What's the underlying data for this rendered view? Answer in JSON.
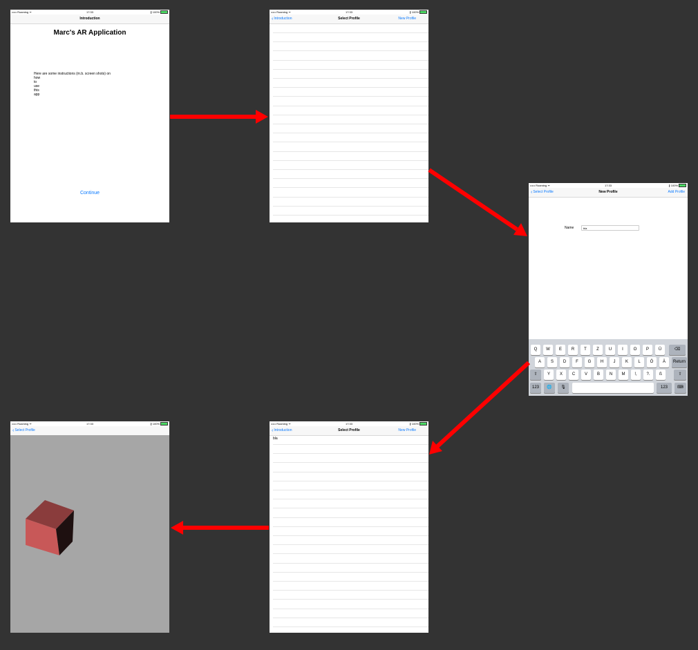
{
  "colors": {
    "background": "#333333",
    "link": "#0a7aff",
    "arrow": "#ff0000",
    "cube_front": "#c85858",
    "cube_top": "#8a3c3c",
    "cube_side": "#1e1010"
  },
  "status_bar": {
    "carrier": "••••• Roaming ᯤ",
    "time": "17:33",
    "battery": "∦ 100%"
  },
  "screen1": {
    "nav_title": "Introduction",
    "app_title": "Marc's AR Application",
    "instructions": [
      "Here are some instructions (m.b. screen shots) on",
      "how",
      "to",
      "use",
      "this",
      "app"
    ],
    "continue_label": "Continue"
  },
  "screen2": {
    "back_label": "Introduction",
    "nav_title": "Select Profile",
    "right_label": "New Profile"
  },
  "screen3": {
    "back_label": "Select Profile",
    "nav_title": "New Profile",
    "right_label": "Add Profile",
    "name_label": "Name",
    "name_value": "bla",
    "keyboard": {
      "row1": [
        "Q",
        "W",
        "E",
        "R",
        "T",
        "Z",
        "U",
        "I",
        "O",
        "P",
        "Ü",
        "⌫"
      ],
      "row2": [
        "A",
        "S",
        "D",
        "F",
        "G",
        "H",
        "J",
        "K",
        "L",
        "Ö",
        "Ä",
        "Return"
      ],
      "row3": [
        "⇧",
        "Y",
        "X",
        "C",
        "V",
        "B",
        "N",
        "M",
        "!,",
        "?.",
        "ß",
        "⇧"
      ],
      "row4": [
        "123",
        "🌐",
        "🎙",
        "",
        "123",
        "⌨"
      ]
    }
  },
  "screen4": {
    "back_label": "Introduction",
    "nav_title": "Select Profile",
    "right_label": "New Profile",
    "rows": [
      "bla"
    ]
  },
  "screen5": {
    "back_label": "Select Profile",
    "scene_object": "cube"
  },
  "flow": [
    "screen1",
    "screen2",
    "screen3",
    "screen4",
    "screen5"
  ]
}
